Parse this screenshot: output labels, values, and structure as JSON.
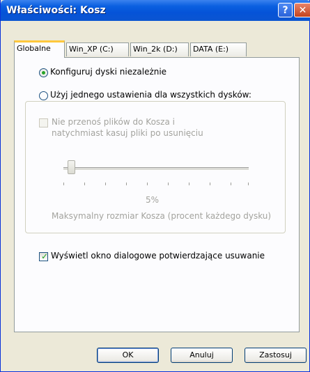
{
  "window": {
    "title": "Właściwości: Kosz"
  },
  "titlebar": {
    "help_glyph": "?",
    "close_glyph": "✕"
  },
  "tabs": [
    {
      "label": "Globalne",
      "active": true
    },
    {
      "label": "Win_XP (C:)",
      "active": false
    },
    {
      "label": "Win_2k (D:)",
      "active": false
    },
    {
      "label": "DATA (E:)",
      "active": false
    }
  ],
  "options": {
    "configure_independently": {
      "label": "Konfiguruj dyski niezależnie",
      "checked": true
    },
    "use_one_setting": {
      "label": "Użyj jednego ustawienia dla wszystkich dysków:",
      "checked": false
    }
  },
  "group": {
    "dont_move_line1": "Nie przenoś plików do Kosza i",
    "dont_move_line2": "natychmiast kasuj pliki po usunięciu",
    "slider_value_label": "5%",
    "slider_value": 5,
    "max_size_label": "Maksymalny rozmiar Kosza (procent każdego dysku)"
  },
  "confirm_dialog": {
    "label": "Wyświetl okno dialogowe potwierdzające usuwanie",
    "checked": true
  },
  "buttons": {
    "ok": "OK",
    "cancel": "Anuluj",
    "apply": "Zastosuj"
  },
  "colors": {
    "titlebar": "#0a5fe0",
    "window_bg": "#ece9d8",
    "check_green": "#21a121",
    "active_tab_accent": "#ffc83c"
  }
}
